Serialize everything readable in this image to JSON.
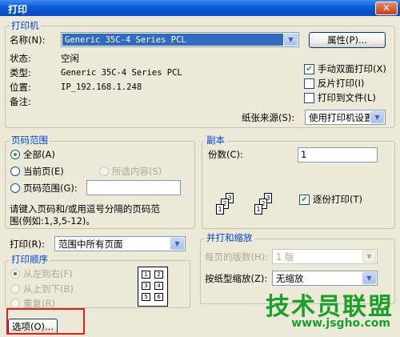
{
  "window": {
    "title": "打印",
    "close": "✕"
  },
  "printer": {
    "group": "打印机",
    "name_label": "名称(N):",
    "name_value": "Generic 35C-4 Series PCL",
    "properties_btn": "属性(P)...",
    "status_label": "状态:",
    "status_value": "空闲",
    "type_label": "类型:",
    "type_value": "Generic 35C-4 Series PCL",
    "location_label": "位置:",
    "location_value": "IP_192.168.1.248",
    "comment_label": "备注:",
    "manual_duplex": "手动双面打印(X)",
    "reverse_print": "反片打印(I)",
    "print_to_file": "打印到文件(L)",
    "paper_source_label": "纸张来源(S):",
    "paper_source_value": "使用打印机设置"
  },
  "page_range": {
    "group": "页码范围",
    "all": "全部(A)",
    "current": "当前页(E)",
    "selection": "所选内容(S)",
    "pages": "页码范围(G):",
    "hint_line1": "请键入页码和/或用逗号分隔的页码范",
    "hint_line2": "围(例如:1,3,5-12)。"
  },
  "copies": {
    "group": "副本",
    "count_label": "份数(C):",
    "count_value": "1",
    "collate": "逐份打印(T)",
    "stack1": [
      "1",
      "2",
      "3"
    ],
    "stack2": [
      "1",
      "2",
      "3"
    ]
  },
  "print_what": {
    "label": "打印(R):",
    "value": "范围中所有页面"
  },
  "print_order": {
    "group": "打印顺序",
    "left_right": "从左到右(F)",
    "top_bottom": "从上到下(B)",
    "repeat": "重复(R)",
    "cells": [
      "1",
      "2",
      "3",
      "4",
      "5",
      "6"
    ]
  },
  "zoom": {
    "group": "并打和缩放",
    "pages_per_sheet_label": "每页的版数(H):",
    "pages_per_sheet_value": "1 版",
    "scale_label": "按纸型缩放(Z):",
    "scale_value": "无缩放"
  },
  "options_btn": "选项(O)...",
  "watermark": {
    "line1": "技术员联盟",
    "line2": "www.jsgho.com"
  },
  "colors": {
    "highlight": "#e0201c",
    "accent": "#0046d5"
  }
}
